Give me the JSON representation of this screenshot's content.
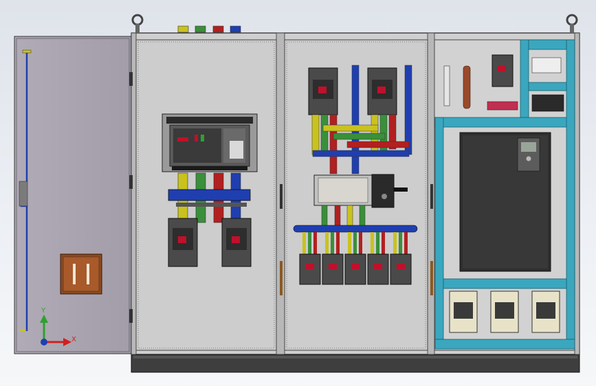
{
  "colors": {
    "background_top": "#dfe3ea",
    "cabinet": "#c9c9c9",
    "door": "#a8a3ad",
    "phase_yellow": "#c9c21e",
    "phase_green": "#3a8f3a",
    "phase_red": "#b22020",
    "neutral_blue": "#1f3fb0",
    "cable_duct": "#3aa7bf",
    "breaker_body": "#4a4a4a",
    "contactor_body": "#e8e3c8",
    "copper": "#9a4a2a"
  },
  "icons": {
    "lifting_eye": "lifting-eye-icon",
    "axis_triad": "axis-triad-icon"
  },
  "labels": {
    "axis_y": "Y",
    "axis_x": "X"
  },
  "phase_markers": [
    "yellow",
    "green",
    "red",
    "blue"
  ],
  "cabinet": {
    "sections": [
      "incoming-section",
      "distribution-section",
      "control-section"
    ],
    "mccb_count_outgoing": 5,
    "contactor_count": 3
  }
}
